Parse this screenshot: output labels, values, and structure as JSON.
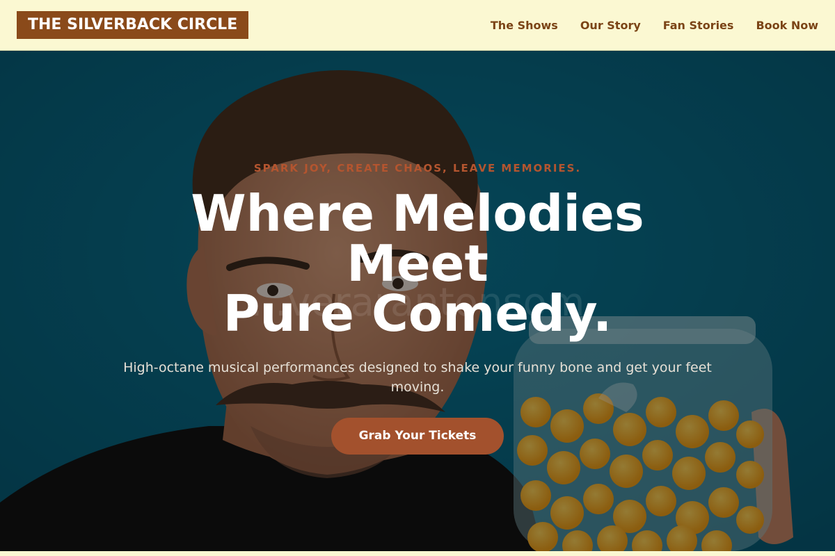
{
  "header": {
    "logo_text": "THE SILVERBACK CIRCLE",
    "nav": [
      {
        "label": "The Shows"
      },
      {
        "label": "Our Story"
      },
      {
        "label": "Fan Stories"
      },
      {
        "label": "Book Now"
      }
    ]
  },
  "hero": {
    "tagline": "SPARK JOY, CREATE CHAOS, LEAVE MEMORIES.",
    "headline_lines": [
      "Where Melodies",
      "Meet",
      "Pure Comedy."
    ],
    "subtext": "High-octane musical performances designed to shake your funny bone and get your feet moving.",
    "cta_label": "Grab Your Tickets",
    "watermark": "...verarantonsom"
  },
  "colors": {
    "header_bg": "#fbf8d2",
    "logo_bg": "#8a4a1a",
    "nav_text": "#7b4416",
    "hero_bg": "#0a6f8c",
    "accent": "#a3512d",
    "tagline": "#b4552f"
  }
}
